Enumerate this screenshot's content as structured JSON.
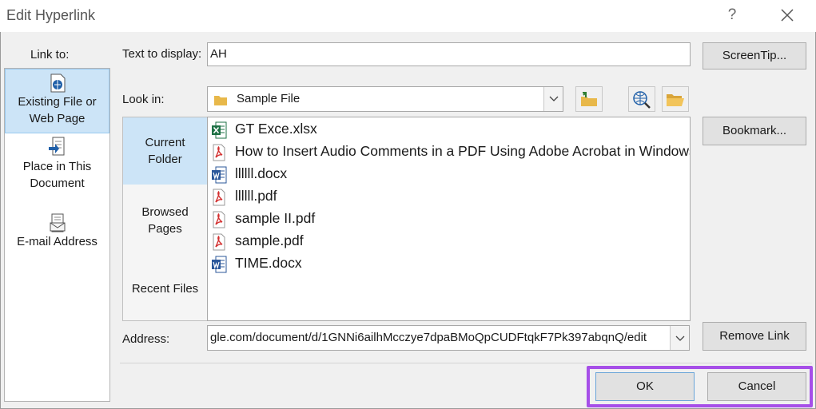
{
  "window": {
    "title": "Edit Hyperlink",
    "help": "?"
  },
  "link_to": {
    "label": "Link to:",
    "items": [
      {
        "line1": "Existing File or",
        "line2": "Web Page",
        "underline": "x",
        "selected": true
      },
      {
        "line1": "Place in This",
        "line2": "Document",
        "underline": "a",
        "selected": false
      },
      {
        "line1": "E-mail Address",
        "line2": "",
        "underline": "m",
        "selected": false
      }
    ]
  },
  "text_to_display": {
    "label": "Text to display:",
    "value": "AH"
  },
  "screentip_button": "ScreenTip...",
  "look_in": {
    "label": "Look in:",
    "value": "Sample File"
  },
  "side_nav": [
    {
      "line1": "Current",
      "line2": "Folder",
      "selected": true
    },
    {
      "line1": "Browsed",
      "line2": "Pages",
      "selected": false
    },
    {
      "line1": "Recent Files",
      "line2": "",
      "selected": false
    }
  ],
  "files": [
    {
      "name": "GT Exce.xlsx",
      "type": "xlsx"
    },
    {
      "name": "How to Insert Audio Comments in a PDF Using Adobe Acrobat in Windows",
      "type": "pdf"
    },
    {
      "name": "llllll.docx",
      "type": "docx"
    },
    {
      "name": "llllll.pdf",
      "type": "pdf"
    },
    {
      "name": "sample II.pdf",
      "type": "pdf"
    },
    {
      "name": "sample.pdf",
      "type": "pdf"
    },
    {
      "name": "TIME.docx",
      "type": "docx"
    }
  ],
  "bookmark_button": "Bookmark...",
  "address": {
    "label": "Address:",
    "value": "gle.com/document/d/1GNNi6ailhMcczye7dpaBMoQpCUDFtqkF7Pk397abqnQ/edit"
  },
  "remove_link_button": "Remove Link",
  "ok_button": "OK",
  "cancel_button": "Cancel",
  "colors": {
    "selection": "#cce4f7",
    "highlight": "#a64fe8",
    "pdf": "#d32f2f",
    "word": "#2b579a",
    "excel": "#1e7145"
  }
}
